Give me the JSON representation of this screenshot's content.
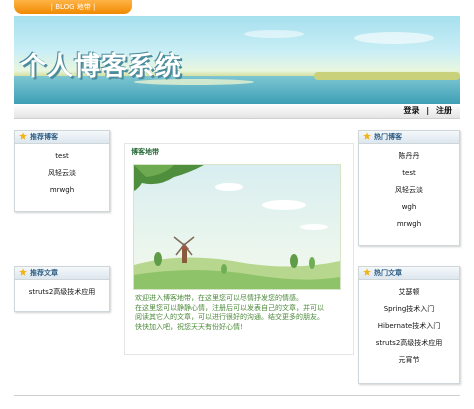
{
  "top_tab": {
    "label": "| BLOG 地带 |"
  },
  "banner": {
    "title": "个人博客系统"
  },
  "nav": {
    "login": "登录",
    "separator": "|",
    "register": "注册"
  },
  "left_top": {
    "title": "推荐博客",
    "items": [
      "test",
      "风轻云淡",
      "mrwgh"
    ]
  },
  "left_bottom": {
    "title": "推荐文章",
    "items": [
      "struts2高级技术应用"
    ]
  },
  "right_top": {
    "title": "热门博客",
    "items": [
      "陈丹丹",
      "test",
      "风轻云淡",
      "wgh",
      "mrwgh"
    ]
  },
  "right_bottom": {
    "title": "热门文章",
    "items": [
      "艾瑟顿",
      "Spring技术入门",
      "Hibernate技术入门",
      "struts2高级技术应用",
      "元宵节"
    ]
  },
  "center": {
    "title": "博客地带",
    "welcome_lines": [
      "欢迎进入博客地带，在这里您可以尽情抒发您的情感。",
      "在这里您可以静静心情，注册后可以发表自己的文章，并可以",
      "阅读其它人的文章，可以进行很好的沟通。结交更多的朋友。",
      "快快加入吧，祝您天天有份好心情!"
    ]
  },
  "colors": {
    "accent_orange": "#f08a00",
    "heading_blue": "#2f5f86",
    "text_green": "#4b8a3a"
  }
}
